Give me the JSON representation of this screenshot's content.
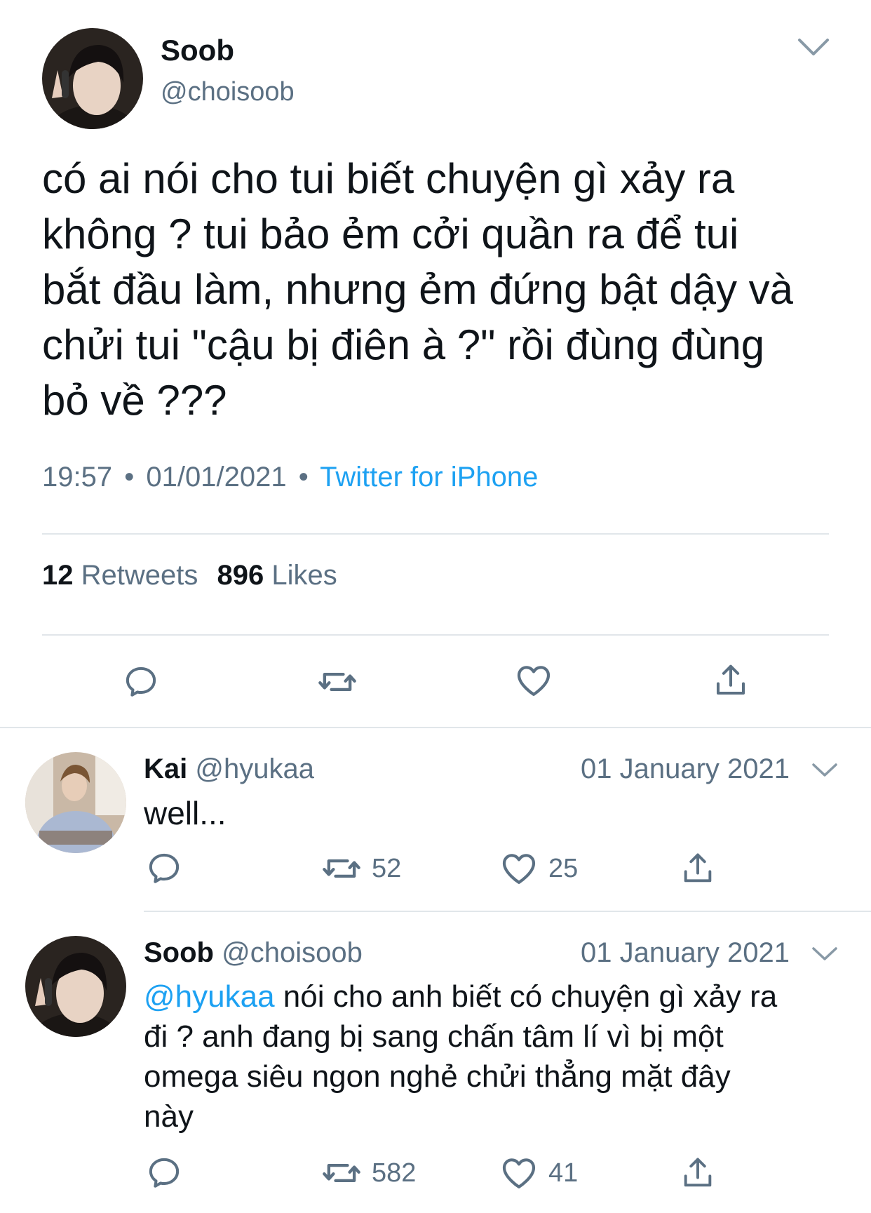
{
  "main_tweet": {
    "display_name": "Soob",
    "handle": "@choisoob",
    "text_lines": [
      "có ai nói cho tui biết chuyện gì xảy ra",
      "không ? tui bảo ẻm cởi quần ra để tui",
      "bắt đầu làm, nhưng ẻm đứng bật dậy và",
      "chửi tui \"cậu bị điên à ?\" rồi đùng đùng",
      "bỏ về ???"
    ],
    "time": "19:57",
    "dot": "•",
    "date": "01/01/2021",
    "source": "Twitter for iPhone",
    "retweets_count": "12",
    "retweets_label": "Retweets",
    "likes_count": "896",
    "likes_label": "Likes"
  },
  "replies": [
    {
      "display_name": "Kai",
      "handle": "@hyukaa",
      "date": "01 January 2021",
      "text_lines": [
        "well..."
      ],
      "retweets": "52",
      "likes": "25"
    },
    {
      "display_name": "Soob",
      "handle": "@choisoob",
      "date": "01 January 2021",
      "mention": "@hyukaa",
      "text_first_line_rest": " nói cho anh biết có chuyện gì xảy ra",
      "text_lines": [
        "đi ? anh đang bị sang chấn tâm lí vì bị một",
        "omega siêu ngon nghẻ chửi thẳng mặt đây",
        "này"
      ],
      "retweets": "582",
      "likes": "41"
    }
  ],
  "icons": {
    "reply": "reply-icon",
    "retweet": "retweet-icon",
    "like": "heart-icon",
    "share": "share-icon",
    "more": "chevron-down-icon"
  },
  "colors": {
    "text": "#0f1419",
    "muted": "#5b7083",
    "link": "#1da1f2",
    "divider": "#e1e6ea"
  }
}
